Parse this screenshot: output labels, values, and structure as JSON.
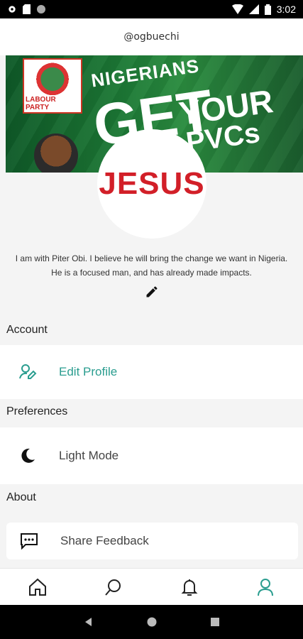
{
  "status_bar": {
    "time": "3:02"
  },
  "header": {
    "username": "@ogbuechi"
  },
  "banner": {
    "party_label": "LABOUR PARTY",
    "headline_1": "NIGERIANS",
    "headline_2": "GET",
    "headline_3": "YOUR",
    "headline_4": "PVCs"
  },
  "avatar": {
    "text": "JESUS",
    "text_color": "#d21f28"
  },
  "bio": {
    "text": "I am with Piter Obi. I believe he will bring the change we want in Nigeria. He is a focused man, and has already made impacts."
  },
  "sections": {
    "account": {
      "title": "Account",
      "edit_profile": "Edit Profile"
    },
    "preferences": {
      "title": "Preferences",
      "light_mode": "Light Mode"
    },
    "about": {
      "title": "About",
      "share_feedback": "Share Feedback"
    }
  },
  "bottom_nav": {
    "items": [
      "home-icon",
      "search-icon",
      "bell-icon",
      "profile-icon"
    ],
    "active": "profile-icon",
    "active_color": "#2a9d8f"
  },
  "colors": {
    "accent": "#2a9d8f"
  }
}
